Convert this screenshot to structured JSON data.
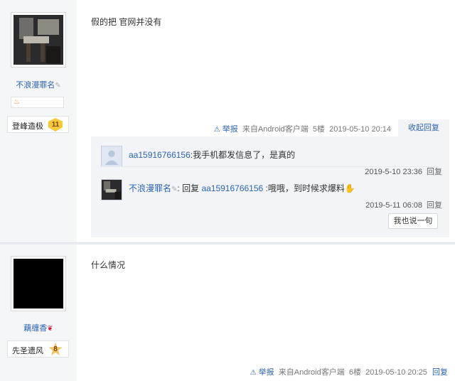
{
  "posts": [
    {
      "username": "不浪漫罪名",
      "level_name": "登峰造极",
      "level_num": "11",
      "content": "假的把 官网并没有",
      "meta": {
        "report": "举报",
        "source": "来自Android客户端",
        "floor": "5楼",
        "time": "2019-05-10 20:14",
        "collapse": "收起回复"
      },
      "replies": [
        {
          "user": "aa15916766156",
          "text": ":我手机都发信息了，是真的",
          "time": "2019-5-10 23:36",
          "reply_label": "回复"
        },
        {
          "user": "不浪漫罪名",
          "reply_word": "回复",
          "target": "aa15916766156",
          "text": " :哦哦，到时候求爆料",
          "time": "2019-5-11 06:08",
          "reply_label": "回复"
        }
      ],
      "say_button": "我也说一句"
    },
    {
      "username": "藕缠香",
      "level_name": "先圣遗风",
      "level_num": "8",
      "content": "什么情况",
      "meta": {
        "report": "举报",
        "source": "来自Android客户端",
        "floor": "6楼",
        "time": "2019-05-10 20:25",
        "reply": "回复"
      }
    }
  ],
  "colors": {
    "link": "#2d64b3",
    "sidebar": "#f5f6f8",
    "lzl_bg": "#f2f4f7",
    "badge_gold": "#f5c93a"
  },
  "icons": [
    "warning-triangle-icon",
    "pen-icon",
    "flame-icon",
    "cherry-icon",
    "gold-hand-icon"
  ]
}
